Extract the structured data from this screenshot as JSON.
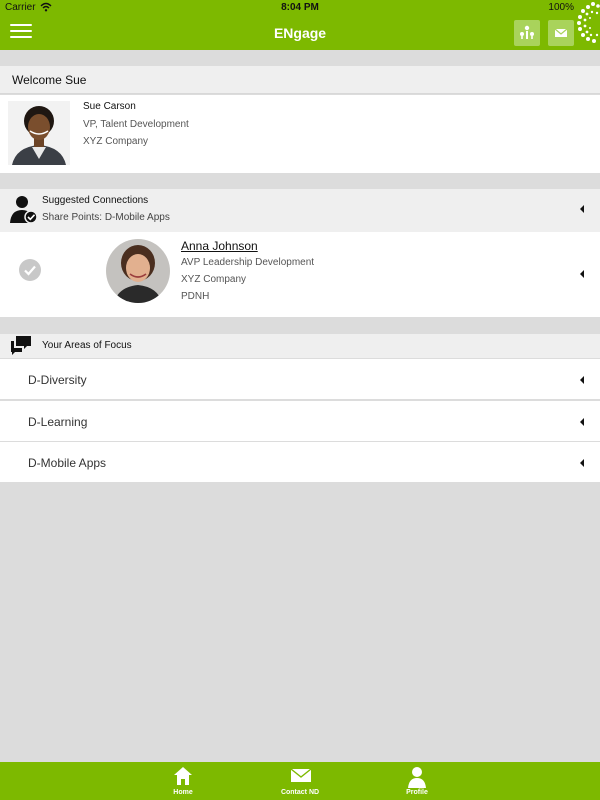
{
  "status": {
    "carrier": "Carrier",
    "time": "8:04 PM",
    "battery": "100%"
  },
  "app": {
    "title": "ENgage"
  },
  "welcome": {
    "title": "Welcome Sue"
  },
  "profile": {
    "name": "Sue Carson",
    "title": "VP, Talent Development",
    "company": "XYZ Company"
  },
  "suggested": {
    "title": "Suggested Connections",
    "subtitle": "Share Points: D-Mobile Apps",
    "connection": {
      "name": "Anna Johnson",
      "title": "AVP Leadership Development",
      "company": "XYZ Company",
      "group": "PDNH"
    }
  },
  "focus": {
    "title": "Your Areas of Focus",
    "items": [
      {
        "label": "D-Diversity"
      },
      {
        "label": "D-Learning"
      },
      {
        "label": "D-Mobile Apps"
      }
    ]
  },
  "tabs": [
    {
      "label": "Home",
      "icon": "home-icon"
    },
    {
      "label": "Contact ND",
      "icon": "mail-icon"
    },
    {
      "label": "Profile",
      "icon": "person-icon"
    }
  ],
  "colors": {
    "accent": "#7db900",
    "header_button": "#a9d35b",
    "background": "#dcdcdc"
  }
}
